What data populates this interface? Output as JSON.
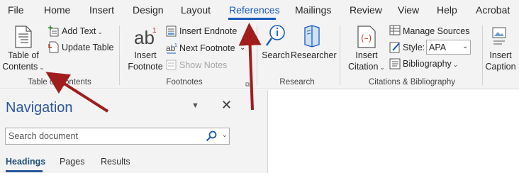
{
  "tabs": [
    {
      "label": "File"
    },
    {
      "label": "Home"
    },
    {
      "label": "Insert"
    },
    {
      "label": "Design"
    },
    {
      "label": "Layout"
    },
    {
      "label": "References"
    },
    {
      "label": "Mailings"
    },
    {
      "label": "Review"
    },
    {
      "label": "View"
    },
    {
      "label": "Help"
    },
    {
      "label": "Acrobat"
    }
  ],
  "active_tab": "References",
  "ribbon": {
    "toc_group": {
      "toc_line1": "Table of",
      "toc_line2": "Contents",
      "add_text": "Add Text",
      "update_table": "Update Table",
      "label": "Table of Contents"
    },
    "footnotes_group": {
      "insert_footnote_line1": "Insert",
      "insert_footnote_line2": "Footnote",
      "insert_endnote": "Insert Endnote",
      "next_footnote": "Next Footnote",
      "show_notes": "Show Notes",
      "label": "Footnotes"
    },
    "research_group": {
      "search": "Search",
      "researcher": "Researcher",
      "label": "Research"
    },
    "citations_group": {
      "insert_citation_line1": "Insert",
      "insert_citation_line2": "Citation",
      "manage_sources": "Manage Sources",
      "style_label": "Style:",
      "style_value": "APA",
      "bibliography": "Bibliography",
      "label": "Citations & Bibliography"
    },
    "captions_group": {
      "insert_caption_line1": "Insert",
      "insert_caption_line2": "Caption"
    }
  },
  "navigation": {
    "title": "Navigation",
    "search_placeholder": "Search document",
    "tabs": [
      {
        "label": "Headings"
      },
      {
        "label": "Pages"
      },
      {
        "label": "Results"
      }
    ]
  },
  "colors": {
    "accent": "#185abd",
    "nav_title": "#2b579a",
    "annotation_arrow": "#a11d1d"
  },
  "icons": [
    "table-of-contents-icon",
    "add-text-icon",
    "update-table-icon",
    "insert-footnote-icon",
    "insert-endnote-icon",
    "next-footnote-icon",
    "show-notes-icon",
    "search-icon",
    "researcher-icon",
    "insert-citation-icon",
    "manage-sources-icon",
    "style-icon",
    "bibliography-icon",
    "insert-caption-icon"
  ]
}
